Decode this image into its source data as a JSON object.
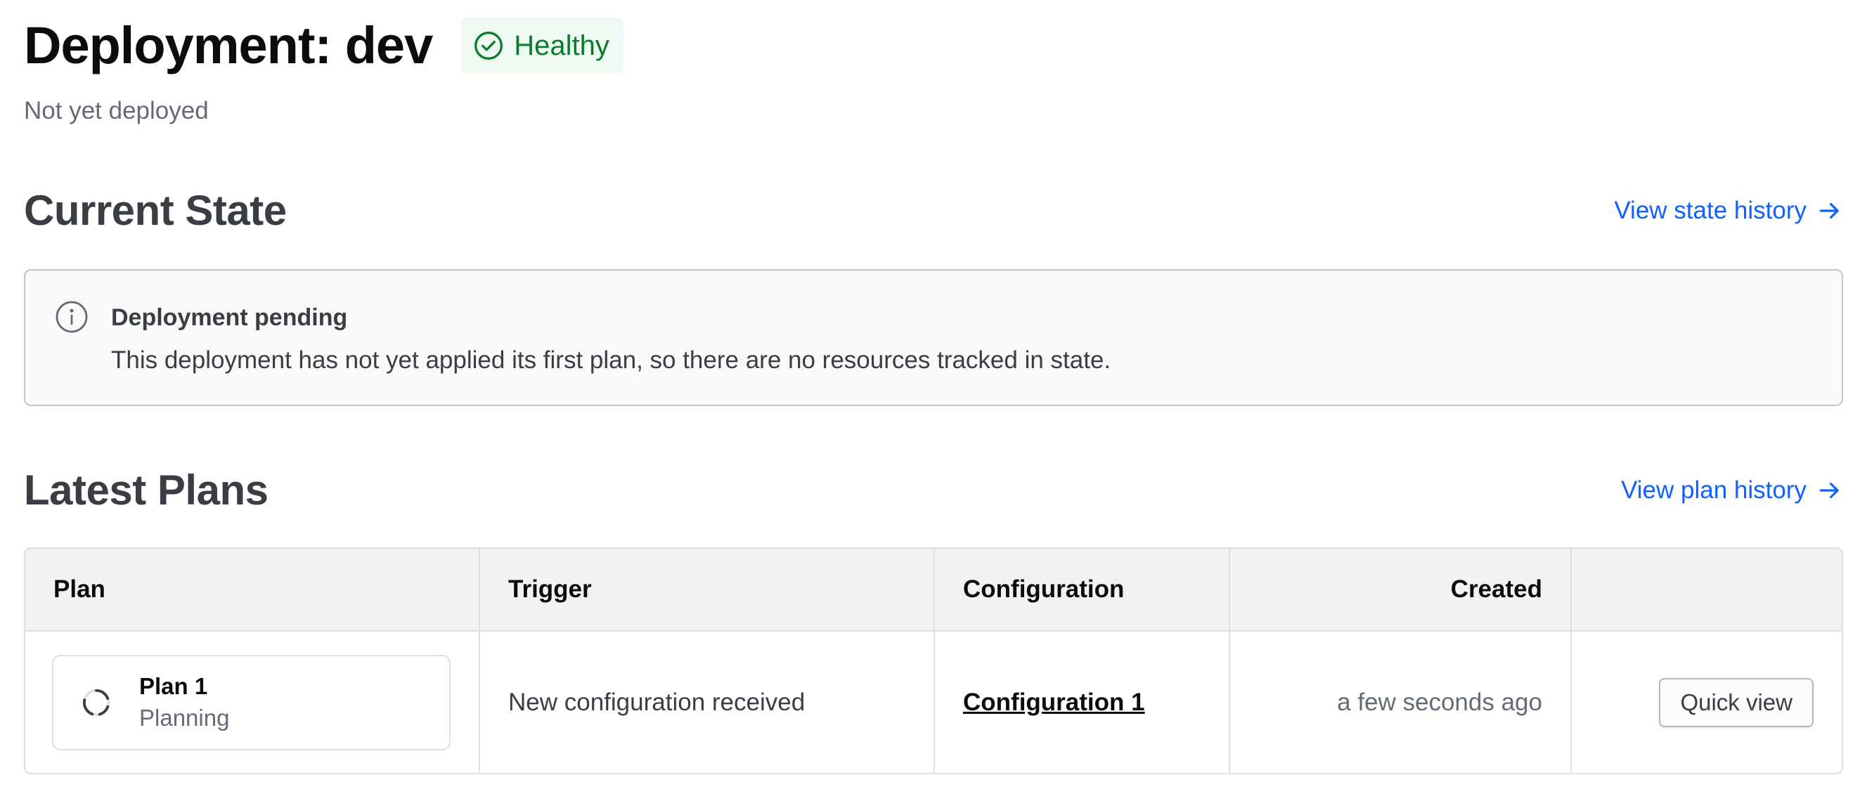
{
  "header": {
    "title": "Deployment: dev",
    "health_badge": "Healthy",
    "subtitle": "Not yet deployed"
  },
  "current_state": {
    "title": "Current State",
    "view_link": "View state history",
    "alert": {
      "icon": "info-icon",
      "title": "Deployment pending",
      "description": "This deployment has not yet applied its first plan, so there are no resources tracked in state."
    }
  },
  "latest_plans": {
    "title": "Latest Plans",
    "view_link": "View plan history",
    "columns": [
      "Plan",
      "Trigger",
      "Configuration",
      "Created",
      ""
    ],
    "rows": [
      {
        "plan_name": "Plan 1",
        "plan_status": "Planning",
        "trigger": "New configuration received",
        "configuration": "Configuration 1",
        "created": "a few seconds ago",
        "action": "Quick view"
      }
    ]
  },
  "colors": {
    "link": "#1060ff",
    "healthy_text": "#0a7d2c",
    "healthy_bg": "#eefaf1"
  }
}
